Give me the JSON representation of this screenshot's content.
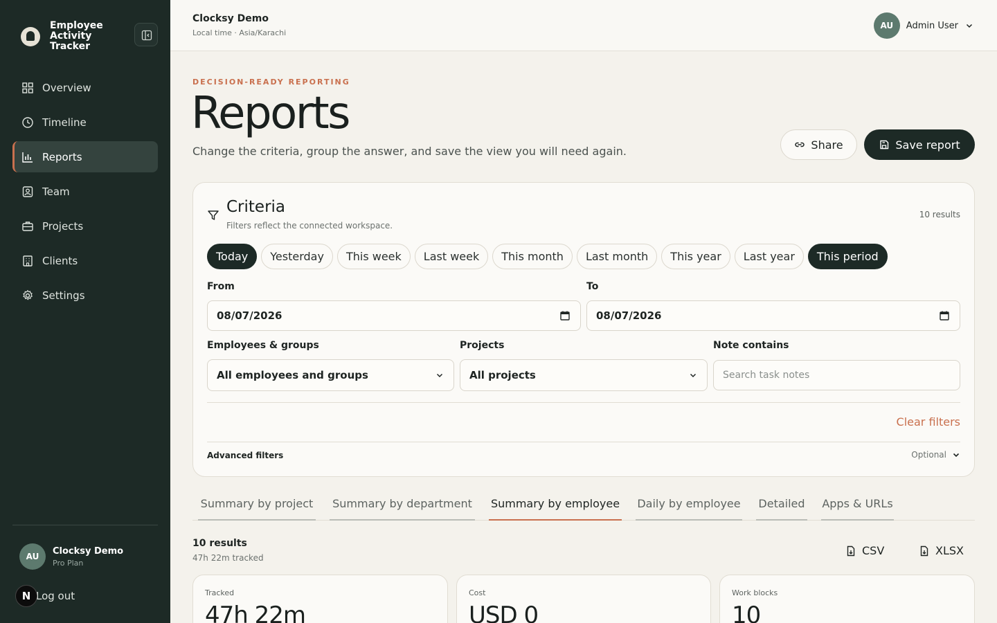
{
  "sidebar": {
    "brand": "Employee Activity Tracker",
    "items": [
      {
        "label": "Overview",
        "icon": "grid-icon"
      },
      {
        "label": "Timeline",
        "icon": "clock-icon"
      },
      {
        "label": "Reports",
        "icon": "bar-chart-icon",
        "active": true
      },
      {
        "label": "Team",
        "icon": "team-icon"
      },
      {
        "label": "Projects",
        "icon": "briefcase-icon"
      },
      {
        "label": "Clients",
        "icon": "building-icon"
      },
      {
        "label": "Settings",
        "icon": "gear-icon"
      }
    ],
    "user": {
      "initials": "AU",
      "name": "Clocksy Demo",
      "plan": "Pro Plan"
    },
    "logout_badge": "N",
    "logout": "Log out"
  },
  "topbar": {
    "workspace": "Clocksy Demo",
    "local_time": "Local time · Asia/Karachi",
    "user_initials": "AU",
    "user_name": "Admin User"
  },
  "header": {
    "eyebrow": "DECISION-READY REPORTING",
    "title": "Reports",
    "subtitle": "Change the criteria, group the answer, and save the view you will need again.",
    "share": "Share",
    "save": "Save report"
  },
  "criteria": {
    "title": "Criteria",
    "subtitle": "Filters reflect the connected workspace.",
    "count": "10 results",
    "ranges": [
      "Today",
      "Yesterday",
      "This week",
      "Last week",
      "This month",
      "Last month",
      "This year",
      "Last year",
      "This period"
    ],
    "selected_ranges": [
      "Today",
      "This period"
    ],
    "from_label": "From",
    "from_value": "08/07/2026",
    "to_label": "To",
    "to_value": "08/07/2026",
    "employees_label": "Employees & groups",
    "employees_value": "All employees and groups",
    "projects_label": "Projects",
    "projects_value": "All projects",
    "note_label": "Note contains",
    "note_placeholder": "Search task notes",
    "clear": "Clear filters",
    "advanced": "Advanced filters",
    "advanced_hint": "Optional"
  },
  "tabs": [
    "Summary by project",
    "Summary by department",
    "Summary by employee",
    "Daily by employee",
    "Detailed",
    "Apps & URLs"
  ],
  "active_tab": "Summary by employee",
  "results": {
    "count": "10 results",
    "tracked": "47h 22m tracked",
    "csv": "CSV",
    "xlsx": "XLSX"
  },
  "stats": [
    {
      "label": "Tracked",
      "value": "47h 22m"
    },
    {
      "label": "Cost",
      "value": "USD 0"
    },
    {
      "label": "Work blocks",
      "value": "10"
    }
  ],
  "colors": {
    "accent": "#c9704e",
    "sidebar": "#1d2a26",
    "background": "#f4f2ec"
  }
}
